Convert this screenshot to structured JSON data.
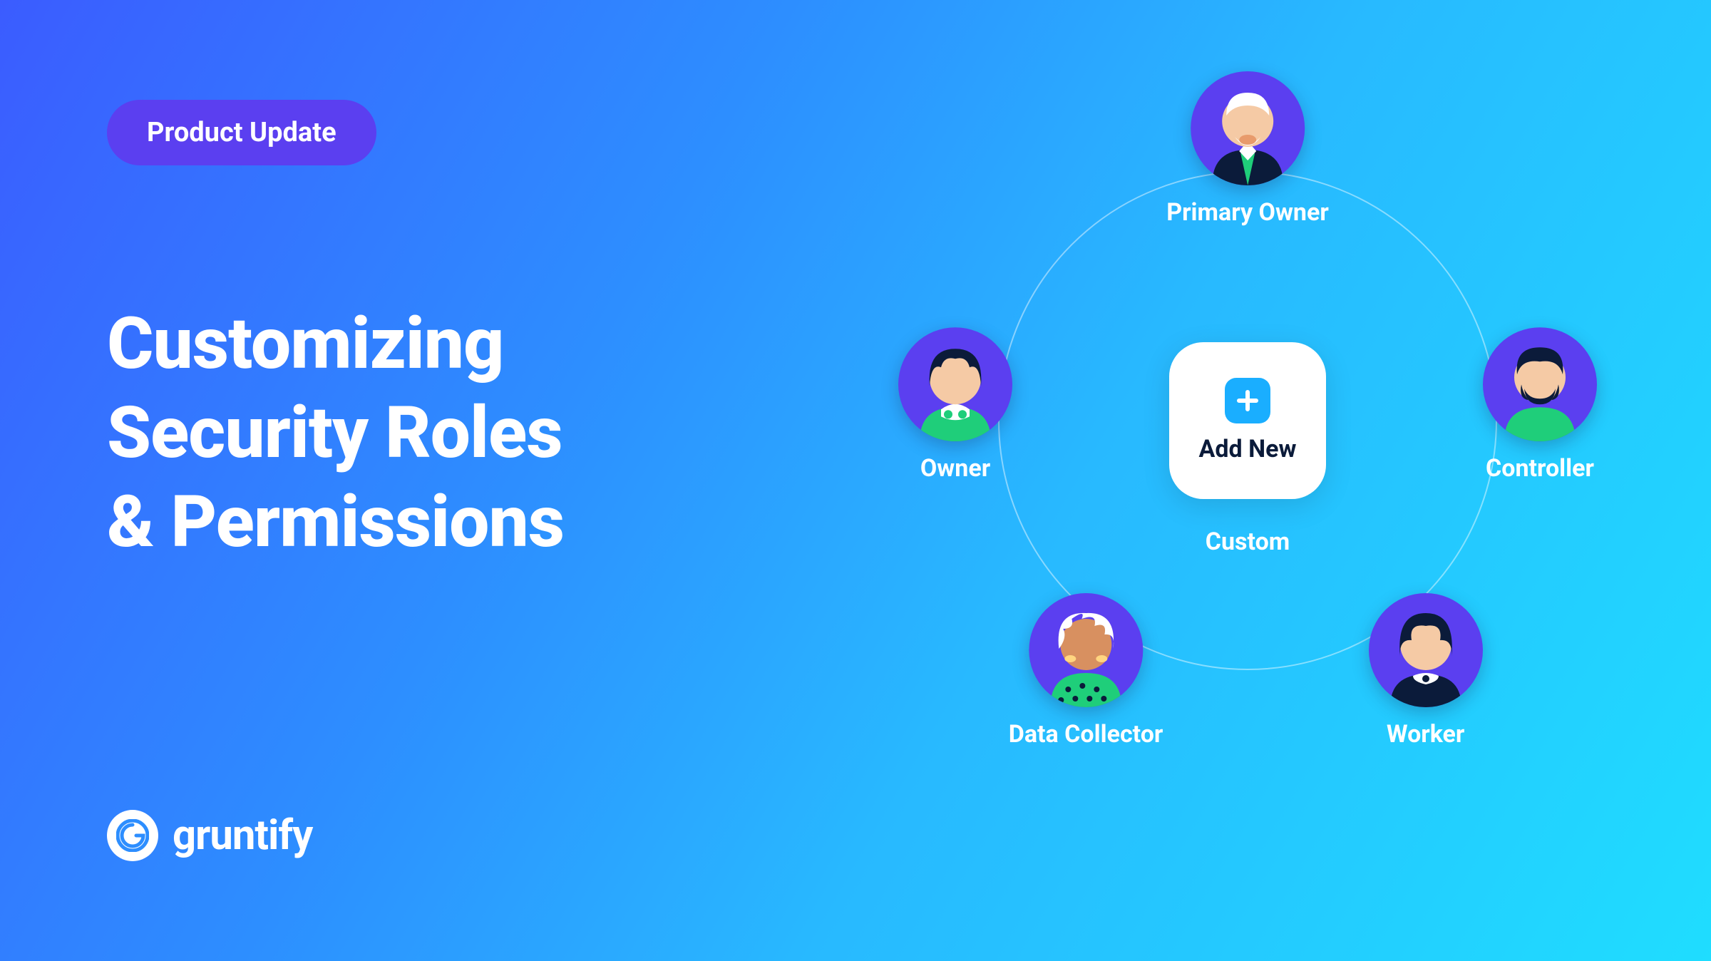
{
  "badge": {
    "label": "Product Update"
  },
  "headline": "Customizing\nSecurity Roles\n& Permissions",
  "logo": {
    "name": "gruntify"
  },
  "center": {
    "button_label": "Add New",
    "sub_label": "Custom"
  },
  "roles": {
    "top": {
      "label": "Primary Owner"
    },
    "left": {
      "label": "Owner"
    },
    "right": {
      "label": "Controller"
    },
    "bl": {
      "label": "Data Collector"
    },
    "br": {
      "label": "Worker"
    }
  }
}
